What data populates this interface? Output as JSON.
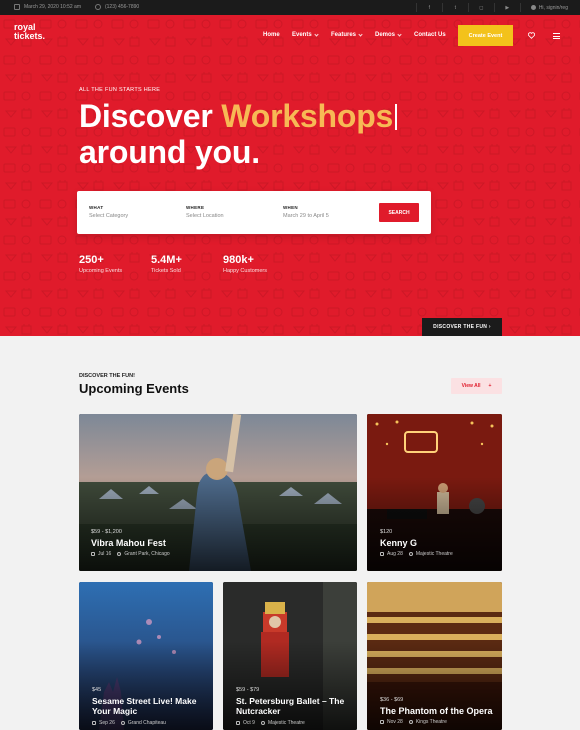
{
  "topbar": {
    "datetime": "March 29, 2020 10:52 am",
    "phone": "(123) 456-7890",
    "social_icons": [
      "facebook-icon",
      "twitter-icon",
      "instagram-icon",
      "youtube-icon"
    ],
    "signin_label": "Hi, signin/reg"
  },
  "nav": {
    "logo_line1": "royal",
    "logo_line2": "tickets.",
    "items": [
      {
        "label": "Home",
        "dropdown": false
      },
      {
        "label": "Events",
        "dropdown": true
      },
      {
        "label": "Features",
        "dropdown": true
      },
      {
        "label": "Demos",
        "dropdown": true
      },
      {
        "label": "Contact Us",
        "dropdown": false
      }
    ],
    "cta_label": "Create Event"
  },
  "hero": {
    "eyebrow": "ALL THE FUN STARTS HERE",
    "headline_prefix": "Discover",
    "headline_highlight": "Workshops",
    "headline_line2": "around you.",
    "accent_color": "#f7b955",
    "background_color": "#e01b2b",
    "search": {
      "what_label": "WHAT",
      "what_value": "Select Category",
      "where_label": "WHERE",
      "where_value": "Select Location",
      "when_label": "WHEN",
      "when_value": "March 29 to April 5",
      "button_label": "SEARCH"
    },
    "stats": [
      {
        "number": "250+",
        "label": "Upcoming Events"
      },
      {
        "number": "5.4M+",
        "label": "Tickets Sold"
      },
      {
        "number": "980k+",
        "label": "Happy Customers"
      }
    ],
    "discover_label": "DISCOVER THE FUN"
  },
  "events": {
    "eyebrow": "DISCOVER THE FUN!",
    "title": "Upcoming Events",
    "view_all_label": "View All",
    "cards": [
      {
        "price": "$59 - $1,200",
        "title": "Vibra Mahou Fest",
        "date": "Jul 16",
        "venue": "Grant Park, Chicago"
      },
      {
        "price": "$120",
        "title": "Kenny G",
        "date": "Aug 28",
        "venue": "Majestic Theatre"
      },
      {
        "price": "$45",
        "title": "Sesame Street Live! Make Your Magic",
        "date": "Sep 26",
        "venue": "Grand Chapiteau"
      },
      {
        "price": "$59 - $79",
        "title": "St. Petersburg Ballet – The Nutcracker",
        "date": "Oct 9",
        "venue": "Majestic Theatre"
      },
      {
        "price": "$36 - $69",
        "title": "The Phantom of the Opera",
        "date": "Nov 28",
        "venue": "Kings Theatre"
      }
    ]
  }
}
